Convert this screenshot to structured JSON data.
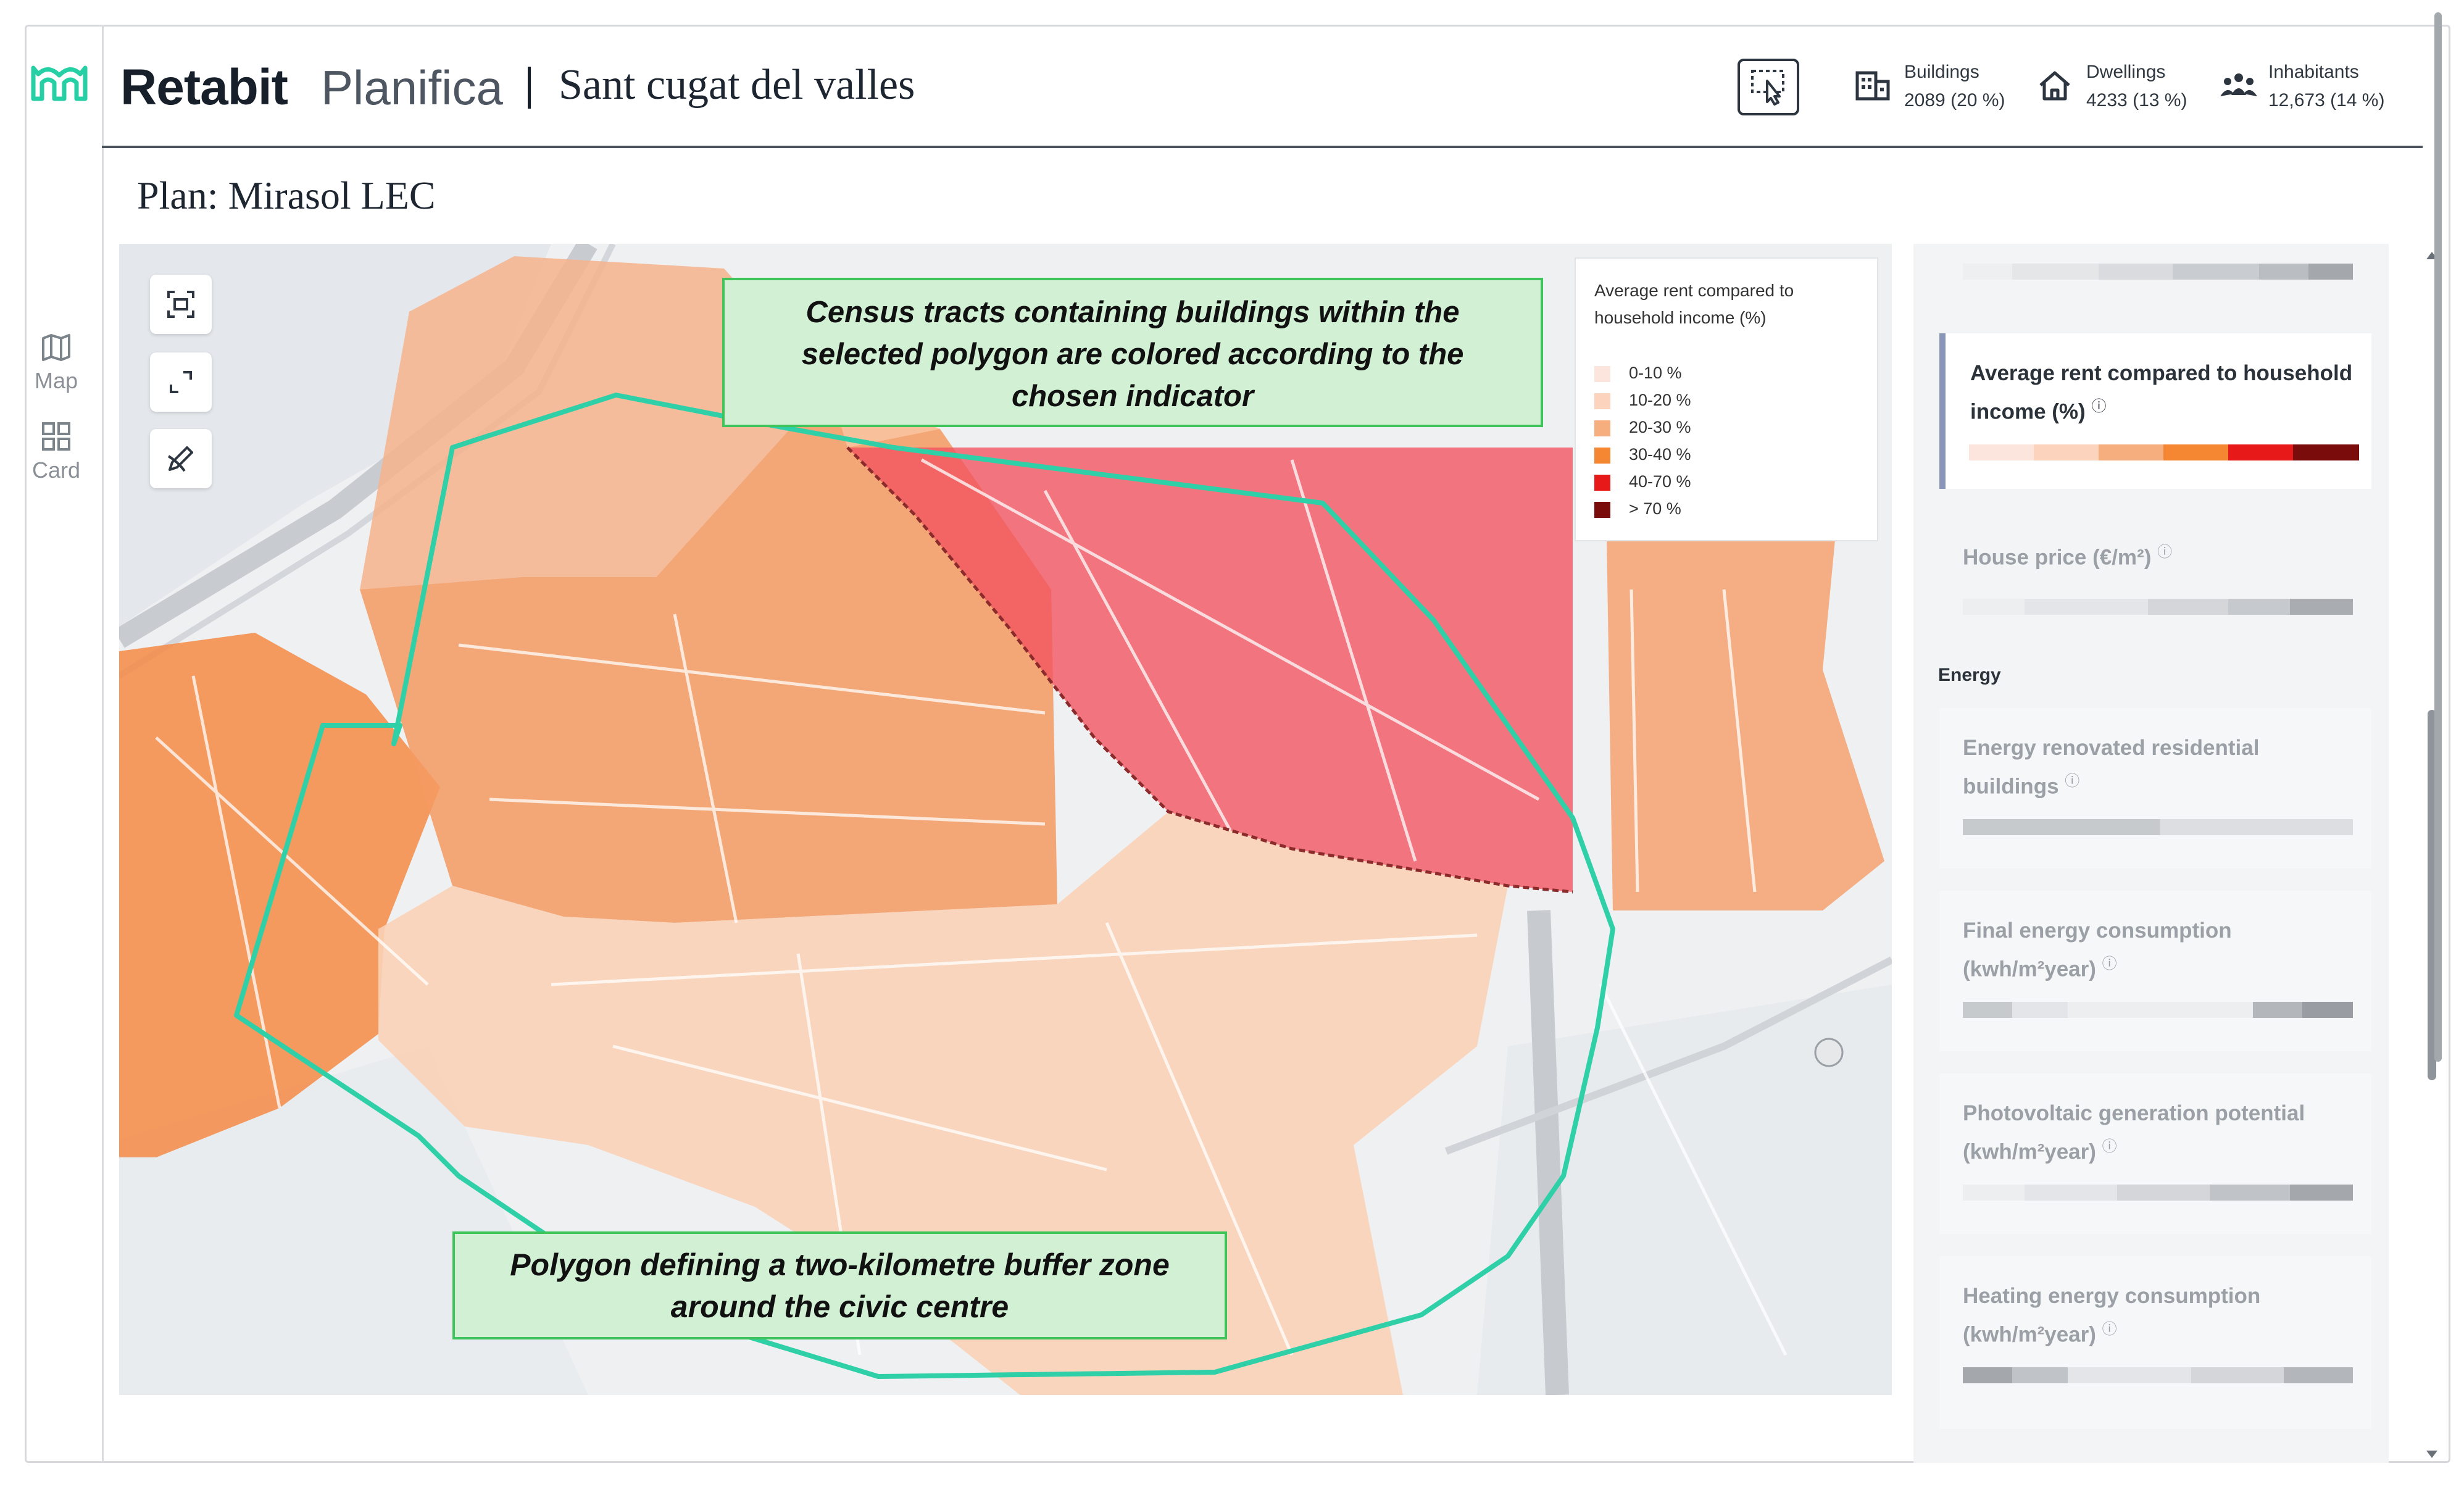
{
  "app": {
    "brand": "Retabit",
    "product": "Planifica",
    "separator": "|",
    "city": "Sant cugat del valles"
  },
  "nav": {
    "items": [
      {
        "label": "Map",
        "icon": "map-icon"
      },
      {
        "label": "Card",
        "icon": "grid-icon"
      }
    ]
  },
  "stats": [
    {
      "title": "Buildings",
      "value": "2089 (20 %)",
      "icon": "building-icon"
    },
    {
      "title": "Dwellings",
      "value": "4233 (13 %)",
      "icon": "house-icon"
    },
    {
      "title": "Inhabitants",
      "value": "12,673 (14 %)",
      "icon": "people-icon"
    }
  ],
  "plan": {
    "title": "Plan: Mirasol LEC"
  },
  "legend": {
    "title": "Average rent compared to household income (%)",
    "items": [
      {
        "label": "0-10 %",
        "color": "#fbe5dc"
      },
      {
        "label": "10-20 %",
        "color": "#fcd3bc"
      },
      {
        "label": "20-30 %",
        "color": "#f7ae7f"
      },
      {
        "label": "30-40 %",
        "color": "#f58733"
      },
      {
        "label": "40-70 %",
        "color": "#e81919"
      },
      {
        "label": "> 70 %",
        "color": "#7a0c0c"
      }
    ]
  },
  "callouts": {
    "top": "Census tracts containing buildings within the selected polygon are colored according to the chosen indicator",
    "bottom": "Polygon defining a two-kilometre buffer zone around the civic centre"
  },
  "panel": {
    "active_card": "Average rent compared to household income (%)",
    "cards": [
      "House price (€/m²)"
    ],
    "energy_heading": "Energy",
    "energy_cards": [
      "Energy renovated residential buildings",
      "Final energy consumption (kwh/m²year)",
      "Photovoltaic generation potential (kwh/m²year)",
      "Heating energy consumption (kwh/m²year)"
    ]
  },
  "colors": {
    "accent": "#26cfa4",
    "polygon": "#2fd0a8",
    "callout_bg": "#d2f0d4",
    "callout_border": "#3ec45a"
  }
}
